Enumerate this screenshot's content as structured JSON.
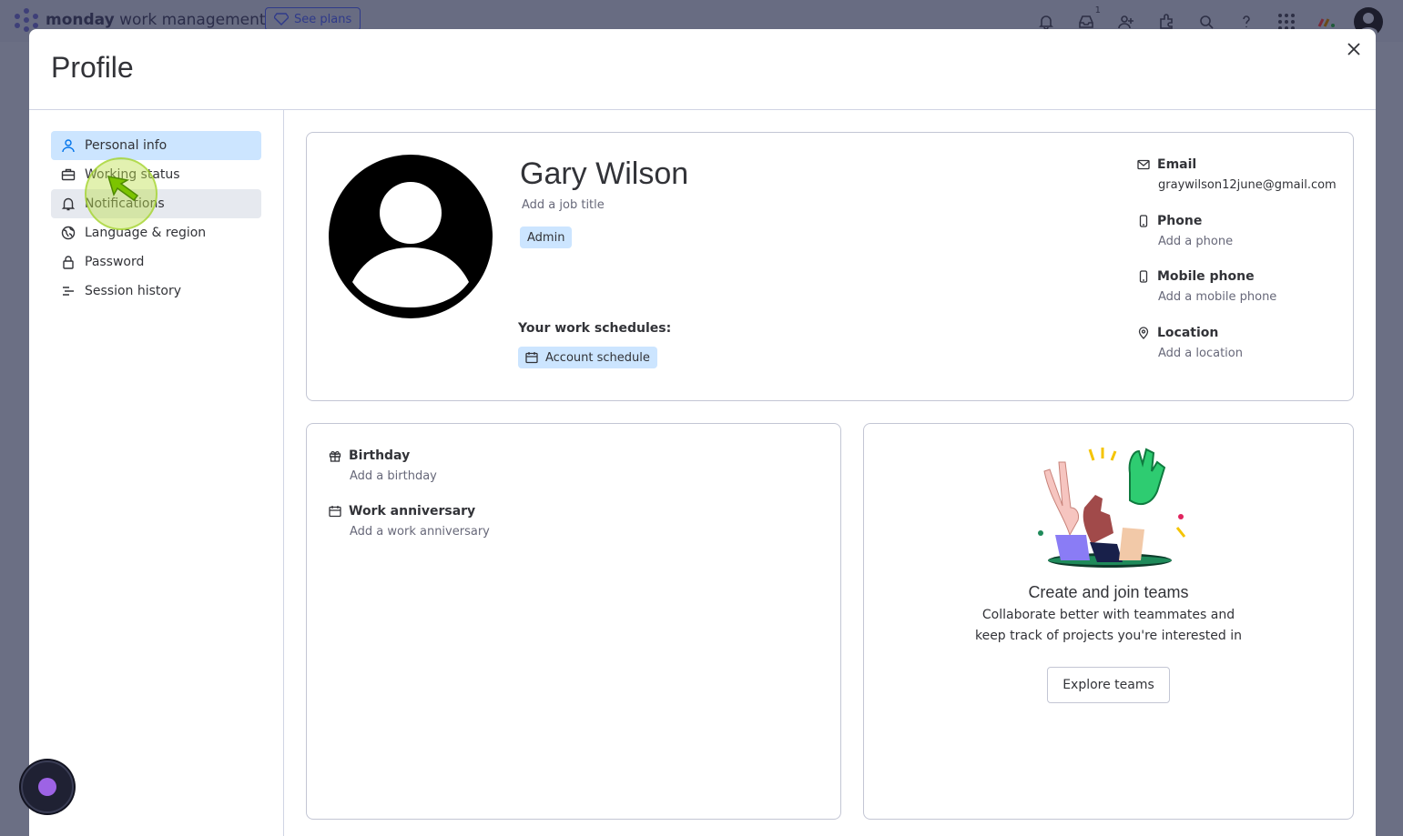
{
  "app": {
    "brand_bold": "monday",
    "brand_rest": " work management",
    "see_plans": "See plans",
    "inbox_count": "1"
  },
  "modal": {
    "title": "Profile"
  },
  "sidebar": {
    "items": [
      {
        "label": "Personal info",
        "icon": "person-icon",
        "state": "active"
      },
      {
        "label": "Working status",
        "icon": "briefcase-icon",
        "state": "normal"
      },
      {
        "label": "Notifications",
        "icon": "bell-icon",
        "state": "hover"
      },
      {
        "label": "Language & region",
        "icon": "globe-icon",
        "state": "normal"
      },
      {
        "label": "Password",
        "icon": "lock-icon",
        "state": "normal"
      },
      {
        "label": "Session history",
        "icon": "list-icon",
        "state": "normal"
      }
    ]
  },
  "profile": {
    "name": "Gary Wilson",
    "job_title_placeholder": "Add a job title",
    "role_tag": "Admin",
    "schedules_label": "Your work schedules:",
    "schedule_tag": "Account schedule"
  },
  "contact": {
    "email": {
      "label": "Email",
      "value": "graywilson12june@gmail.com"
    },
    "phone": {
      "label": "Phone",
      "value": "Add a phone"
    },
    "mobile": {
      "label": "Mobile phone",
      "value": "Add a mobile phone"
    },
    "location": {
      "label": "Location",
      "value": "Add a location"
    }
  },
  "dates": {
    "birthday": {
      "label": "Birthday",
      "value": "Add a birthday"
    },
    "anniversary": {
      "label": "Work anniversary",
      "value": "Add a work anniversary"
    }
  },
  "teams": {
    "title": "Create and join teams",
    "desc_line1": "Collaborate better with teammates and",
    "desc_line2": "keep track of projects you're interested in",
    "button": "Explore teams"
  },
  "colors": {
    "accent": "#0073ea",
    "active_bg": "#cce5ff",
    "hover_bg": "#e6e9ef",
    "overlay": "#6b6f84",
    "assistant": "#9d63e5"
  }
}
